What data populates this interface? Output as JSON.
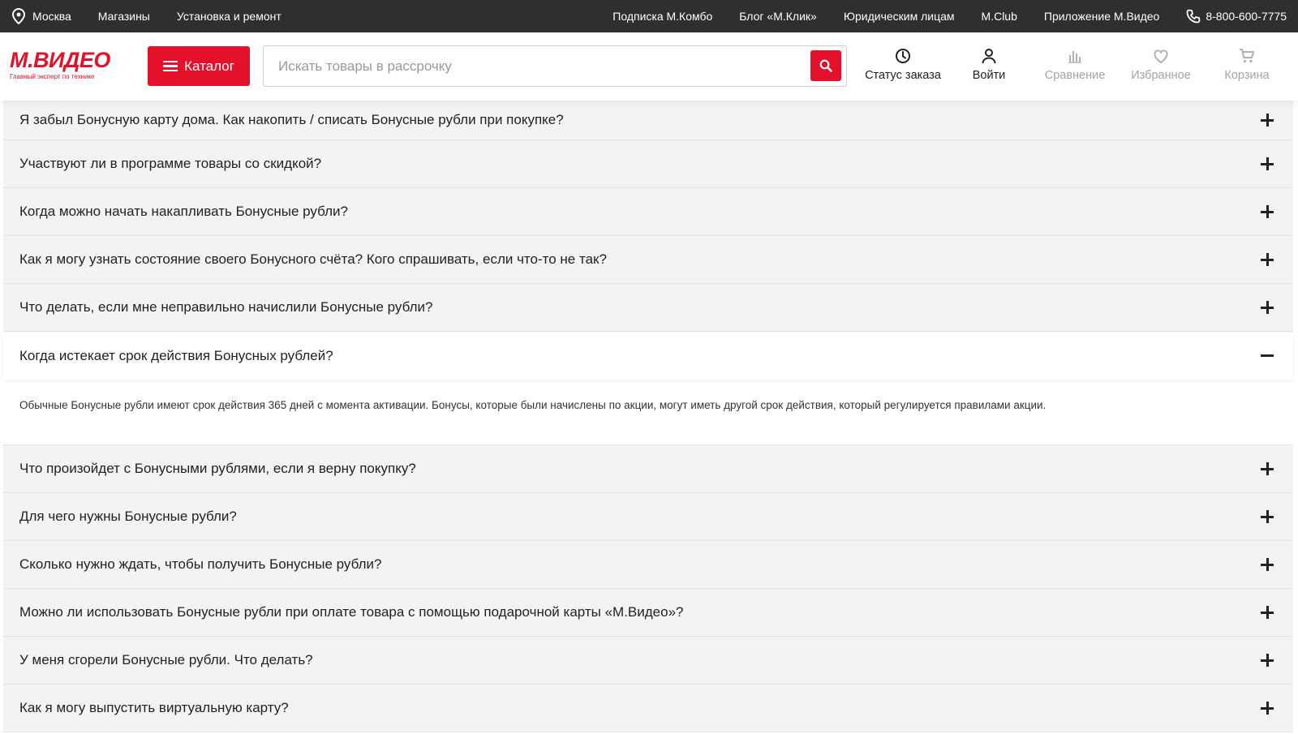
{
  "topbar": {
    "city": "Москва",
    "left_links": [
      "Магазины",
      "Установка и ремонт"
    ],
    "right_links": [
      "Подписка М.Комбо",
      "Блог «М.Клик»",
      "Юридическим лицам",
      "M.Club",
      "Приложение М.Видео"
    ],
    "phone": "8-800-600-7775"
  },
  "header": {
    "logo_text": "М.ВИДЕО",
    "logo_tagline": "Главный эксперт по технике",
    "catalog_label": "Каталог",
    "search_placeholder": "Искать товары в рассрочку",
    "icons": {
      "order_status": "Статус заказа",
      "login": "Войти",
      "compare": "Сравнение",
      "favorites": "Избранное",
      "cart": "Корзина"
    }
  },
  "colors": {
    "accent": "#e4112a",
    "topbar_bg": "#2f2f2f",
    "row_bg": "#f2f3f5"
  },
  "faq": {
    "items_before": [
      "Я забыл Бонусную карту дома. Как накопить / списать Бонусные рубли при покупке?",
      "Участвуют ли в программе товары со скидкой?",
      "Когда можно начать накапливать Бонусные рубли?",
      "Как я могу узнать состояние своего Бонусного счёта? Кого спрашивать, если что-то не так?",
      "Что делать, если мне неправильно начислили Бонусные рубли?"
    ],
    "open_item": {
      "question": "Когда истекает срок действия Бонусных рублей?",
      "answer": "Обычные Бонусные рубли имеют срок действия 365 дней с момента активации. Бонусы, которые были начислены по акции, могут иметь другой срок действия, который регулируется правилами акции."
    },
    "items_after": [
      "Что произойдет с Бонусными рублями, если я верну покупку?",
      "Для чего нужны Бонусные рубли?",
      "Сколько нужно ждать, чтобы получить Бонусные рубли?",
      "Можно ли использовать Бонусные рубли при оплате товара с помощью подарочной карты «М.Видео»?",
      "У меня сгорели Бонусные рубли. Что делать?",
      "Как я могу выпустить виртуальную карту?"
    ]
  }
}
